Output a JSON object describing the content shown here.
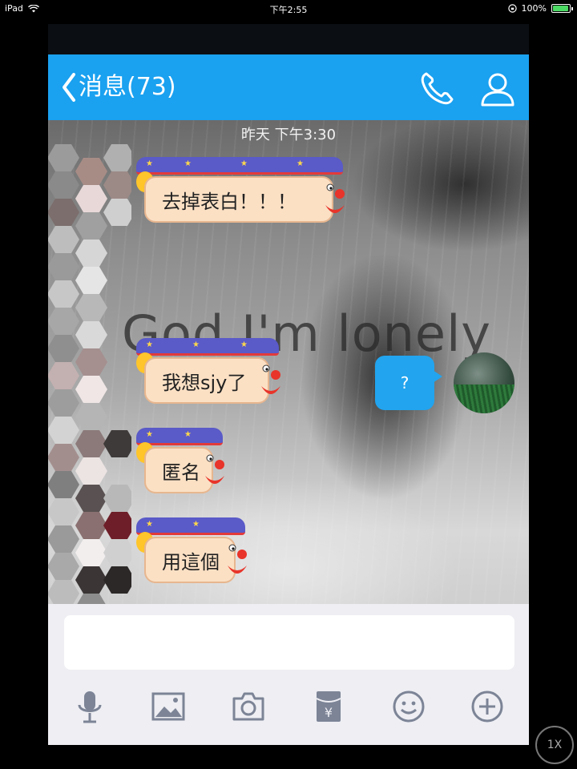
{
  "status_bar": {
    "device": "iPad",
    "time": "下午2:55",
    "battery": "100%"
  },
  "nav": {
    "back_label": "消息(73)"
  },
  "chat": {
    "timestamp": "昨天 下午3:30",
    "background_text": "God I'm lonely",
    "messages": [
      {
        "side": "left",
        "text": "去掉表白！！！"
      },
      {
        "side": "right",
        "text": "?"
      },
      {
        "side": "left",
        "text": "我想sjy了"
      },
      {
        "side": "left",
        "text": "匿名"
      },
      {
        "side": "left",
        "text": "用這個"
      }
    ]
  },
  "toolbar": {
    "icons": [
      "microphone-icon",
      "image-icon",
      "camera-icon",
      "red-packet-icon",
      "emoji-icon",
      "plus-icon"
    ]
  },
  "playback": {
    "speed_label": "1X"
  },
  "colors": {
    "nav_blue": "#1aa1f0",
    "sent_bubble": "#22a4ee",
    "toolbar_bg": "#eeeef3",
    "icon_gray": "#7c8496"
  }
}
